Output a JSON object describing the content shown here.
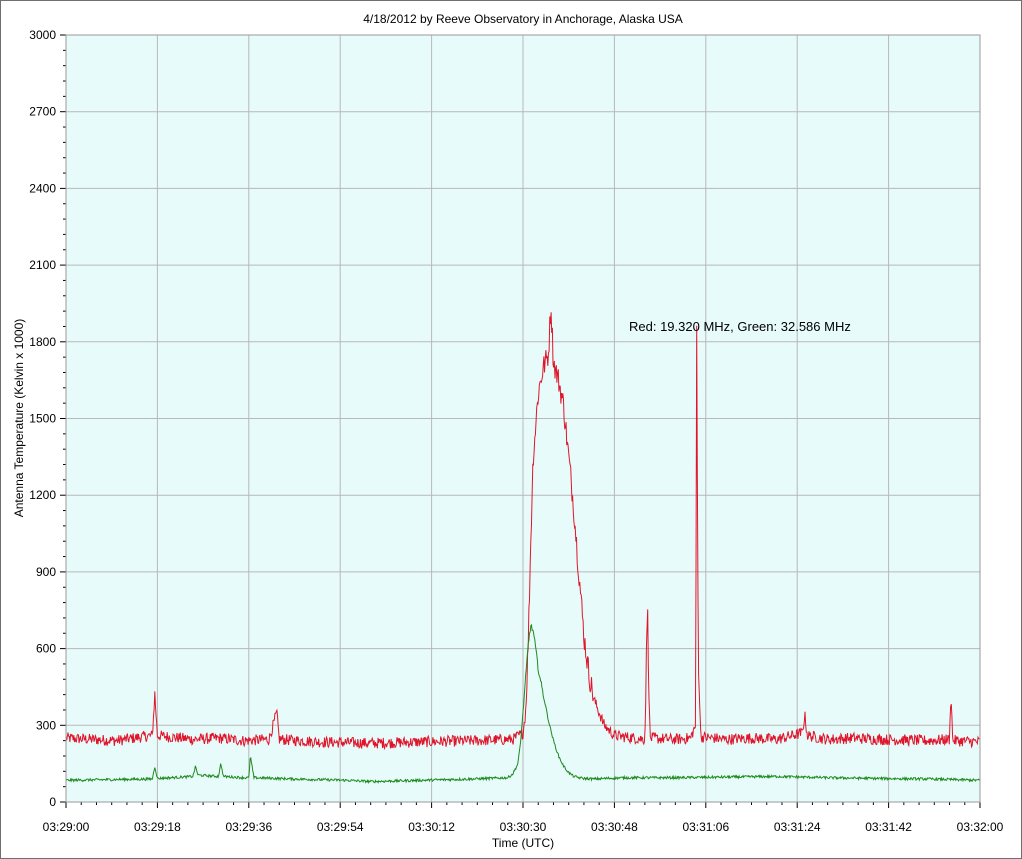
{
  "chart_data": {
    "type": "line",
    "title": "4/18/2012  by  Reeve Observatory  in  Anchorage, Alaska  USA",
    "xlabel": "Time (UTC)",
    "ylabel": "Antenna Temperature (Kelvin x 1000)",
    "annotation": "Red: 19.320 MHz, Green: 32.586 MHz",
    "xlim_seconds": [
      0,
      180
    ],
    "ylim": [
      0,
      3000
    ],
    "x_ticks": [
      "03:29:00",
      "03:29:18",
      "03:29:36",
      "03:29:54",
      "03:30:12",
      "03:30:30",
      "03:30:48",
      "03:31:06",
      "03:31:24",
      "03:31:42",
      "03:32:00"
    ],
    "y_ticks": [
      0,
      300,
      600,
      900,
      1200,
      1500,
      1800,
      2100,
      2400,
      2700,
      3000
    ],
    "grid": true,
    "plot_background": "#e8fbfb",
    "series": [
      {
        "name": "Red: 19.320 MHz",
        "color": "#e0142a",
        "x": [
          0,
          5,
          10,
          15,
          17,
          17.5,
          18,
          25,
          30,
          35,
          40,
          41.5,
          42,
          50,
          60,
          70,
          80,
          88,
          90,
          90.5,
          91,
          91.5,
          92,
          93,
          94,
          95,
          95.5,
          96,
          97,
          98,
          99,
          100,
          101,
          102,
          103,
          104,
          105,
          106,
          107,
          108,
          110,
          112,
          114,
          114.5,
          115,
          120,
          123,
          124,
          124.2,
          124.5,
          125,
          130,
          135,
          140,
          145,
          145.5,
          146,
          150,
          155,
          160,
          170,
          174,
          174.3,
          174.6,
          175,
          180
        ],
        "y": [
          250,
          245,
          240,
          255,
          260,
          420,
          260,
          245,
          250,
          240,
          245,
          350,
          245,
          235,
          230,
          235,
          240,
          245,
          270,
          350,
          600,
          1000,
          1350,
          1600,
          1700,
          1750,
          1950,
          1720,
          1650,
          1550,
          1350,
          1150,
          900,
          650,
          500,
          400,
          350,
          300,
          280,
          260,
          255,
          250,
          245,
          780,
          250,
          245,
          250,
          300,
          1850,
          600,
          255,
          245,
          250,
          245,
          270,
          340,
          260,
          245,
          250,
          245,
          240,
          245,
          450,
          245,
          240,
          235
        ]
      },
      {
        "name": "Green: 32.586 MHz",
        "color": "#1d8a1d",
        "x": [
          0,
          10,
          17,
          17.5,
          18,
          25,
          25.5,
          26,
          30,
          30.5,
          31,
          35,
          36,
          36.3,
          37,
          45,
          55,
          60,
          70,
          80,
          87,
          88,
          89,
          89.5,
          90,
          90.5,
          91,
          91.5,
          92,
          92.5,
          93,
          94,
          95,
          96,
          97,
          98,
          99,
          100,
          101,
          102,
          104,
          106,
          110,
          120,
          140,
          150,
          160,
          170,
          180
        ],
        "y": [
          85,
          88,
          90,
          140,
          92,
          100,
          140,
          105,
          100,
          150,
          100,
          95,
          95,
          180,
          95,
          90,
          85,
          80,
          85,
          90,
          95,
          110,
          150,
          230,
          350,
          480,
          610,
          690,
          670,
          600,
          520,
          420,
          320,
          240,
          180,
          140,
          115,
          100,
          95,
          92,
          90,
          92,
          95,
          95,
          100,
          95,
          92,
          90,
          85
        ]
      }
    ]
  }
}
